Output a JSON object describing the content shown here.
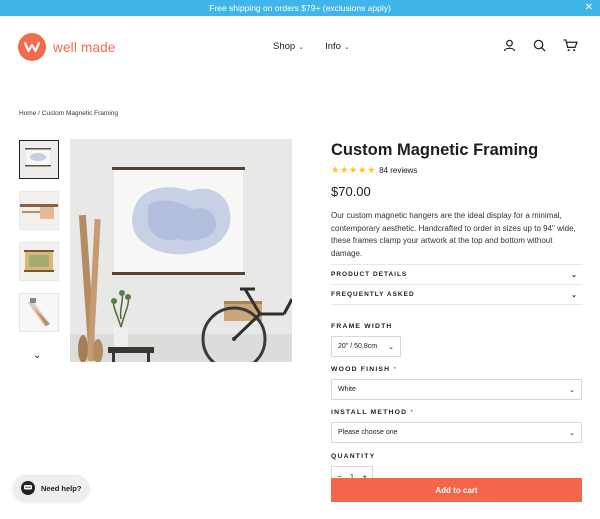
{
  "announcement": {
    "text": "Free shipping on orders $79+ (exclusions apply)"
  },
  "header": {
    "logo_text": "well made",
    "nav": [
      {
        "label": "Shop"
      },
      {
        "label": "Info"
      }
    ]
  },
  "breadcrumb": {
    "home": "Home",
    "sep": "/",
    "current": "Custom Magnetic Framing"
  },
  "product": {
    "title": "Custom Magnetic Framing",
    "rating_stars": 5,
    "reviews": "84 reviews",
    "price": "$70.00",
    "description": "Our custom magnetic hangers are the ideal display for a minimal, contemporary aesthetic. Handcrafted to order in sizes up to 94\" wide, these frames clamp your artwork at the top and bottom without damage."
  },
  "collapsibles": [
    {
      "label": "PRODUCT DETAILS"
    },
    {
      "label": "FREQUENTLY ASKED"
    }
  ],
  "options": {
    "frame_width": {
      "label": "FRAME WIDTH",
      "value": "20\" / 50.8cm"
    },
    "wood_finish": {
      "label": "WOOD FINISH",
      "required": "*",
      "value": "White"
    },
    "install_method": {
      "label": "INSTALL METHOD",
      "required": "*",
      "value": "Please choose one"
    },
    "quantity": {
      "label": "QUANTITY",
      "value": "1",
      "minus": "−",
      "plus": "+"
    }
  },
  "add_to_cart": "Add to cart",
  "chat": {
    "label": "Need help?"
  },
  "colors": {
    "announcement": "#3fb5ea",
    "brand": "#f36b4c",
    "button": "#f4654a",
    "stars": "#f7c52b"
  }
}
